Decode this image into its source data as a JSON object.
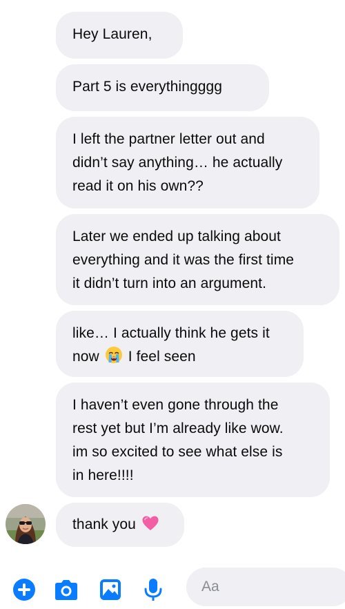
{
  "thread": {
    "messages": [
      {
        "lines": [
          "Hey Lauren,"
        ]
      },
      {
        "lines": [
          "Part 5 is everythingggg"
        ]
      },
      {
        "lines": [
          "I left the partner letter out and",
          "didn’t say anything… he actually",
          "read it on his own??"
        ]
      },
      {
        "lines": [
          "Later we ended up talking about",
          "everything and it was the first time",
          "it didn’t turn into an argument."
        ]
      },
      {
        "lines": [
          "like… I actually think he gets it"
        ],
        "line2_before": "now",
        "line2_after": "I feel seen",
        "emoji": "loudly-crying-face-icon"
      },
      {
        "lines": [
          "I haven’t even gone through the",
          "rest yet but I’m already like wow.",
          "im so excited to see what else is",
          "in here!!!!"
        ]
      },
      {
        "text": "thank you",
        "emoji": "pink-heart-icon"
      }
    ]
  },
  "composer": {
    "placeholder": "Aa",
    "icons": [
      "plus-circle-icon",
      "camera-icon",
      "image-icon",
      "microphone-icon"
    ]
  },
  "colors": {
    "accent": "#0a7cff",
    "bubble": "#efeff4",
    "text": "#050505",
    "placeholder": "#8a8d91"
  }
}
